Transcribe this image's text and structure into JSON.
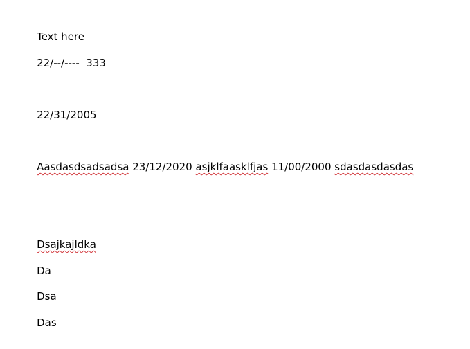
{
  "document": {
    "line1": "Text here",
    "line2": "22/--/----  333",
    "line3": "22/31/2005",
    "line4": {
      "word1": "Aasdasdsadsadsa",
      "text1": " 23/12/2020 ",
      "word2": "asjklfaasklfjas",
      "text2": " 11/00/2000 ",
      "word3": "sdasdasdasdas"
    },
    "line5": "Dsajkajldka",
    "line6": "Da",
    "line7": "Dsa",
    "line8": "Das"
  },
  "colors": {
    "background": "#ffffff",
    "text": "#000000",
    "spellcheck": "#d13438"
  }
}
